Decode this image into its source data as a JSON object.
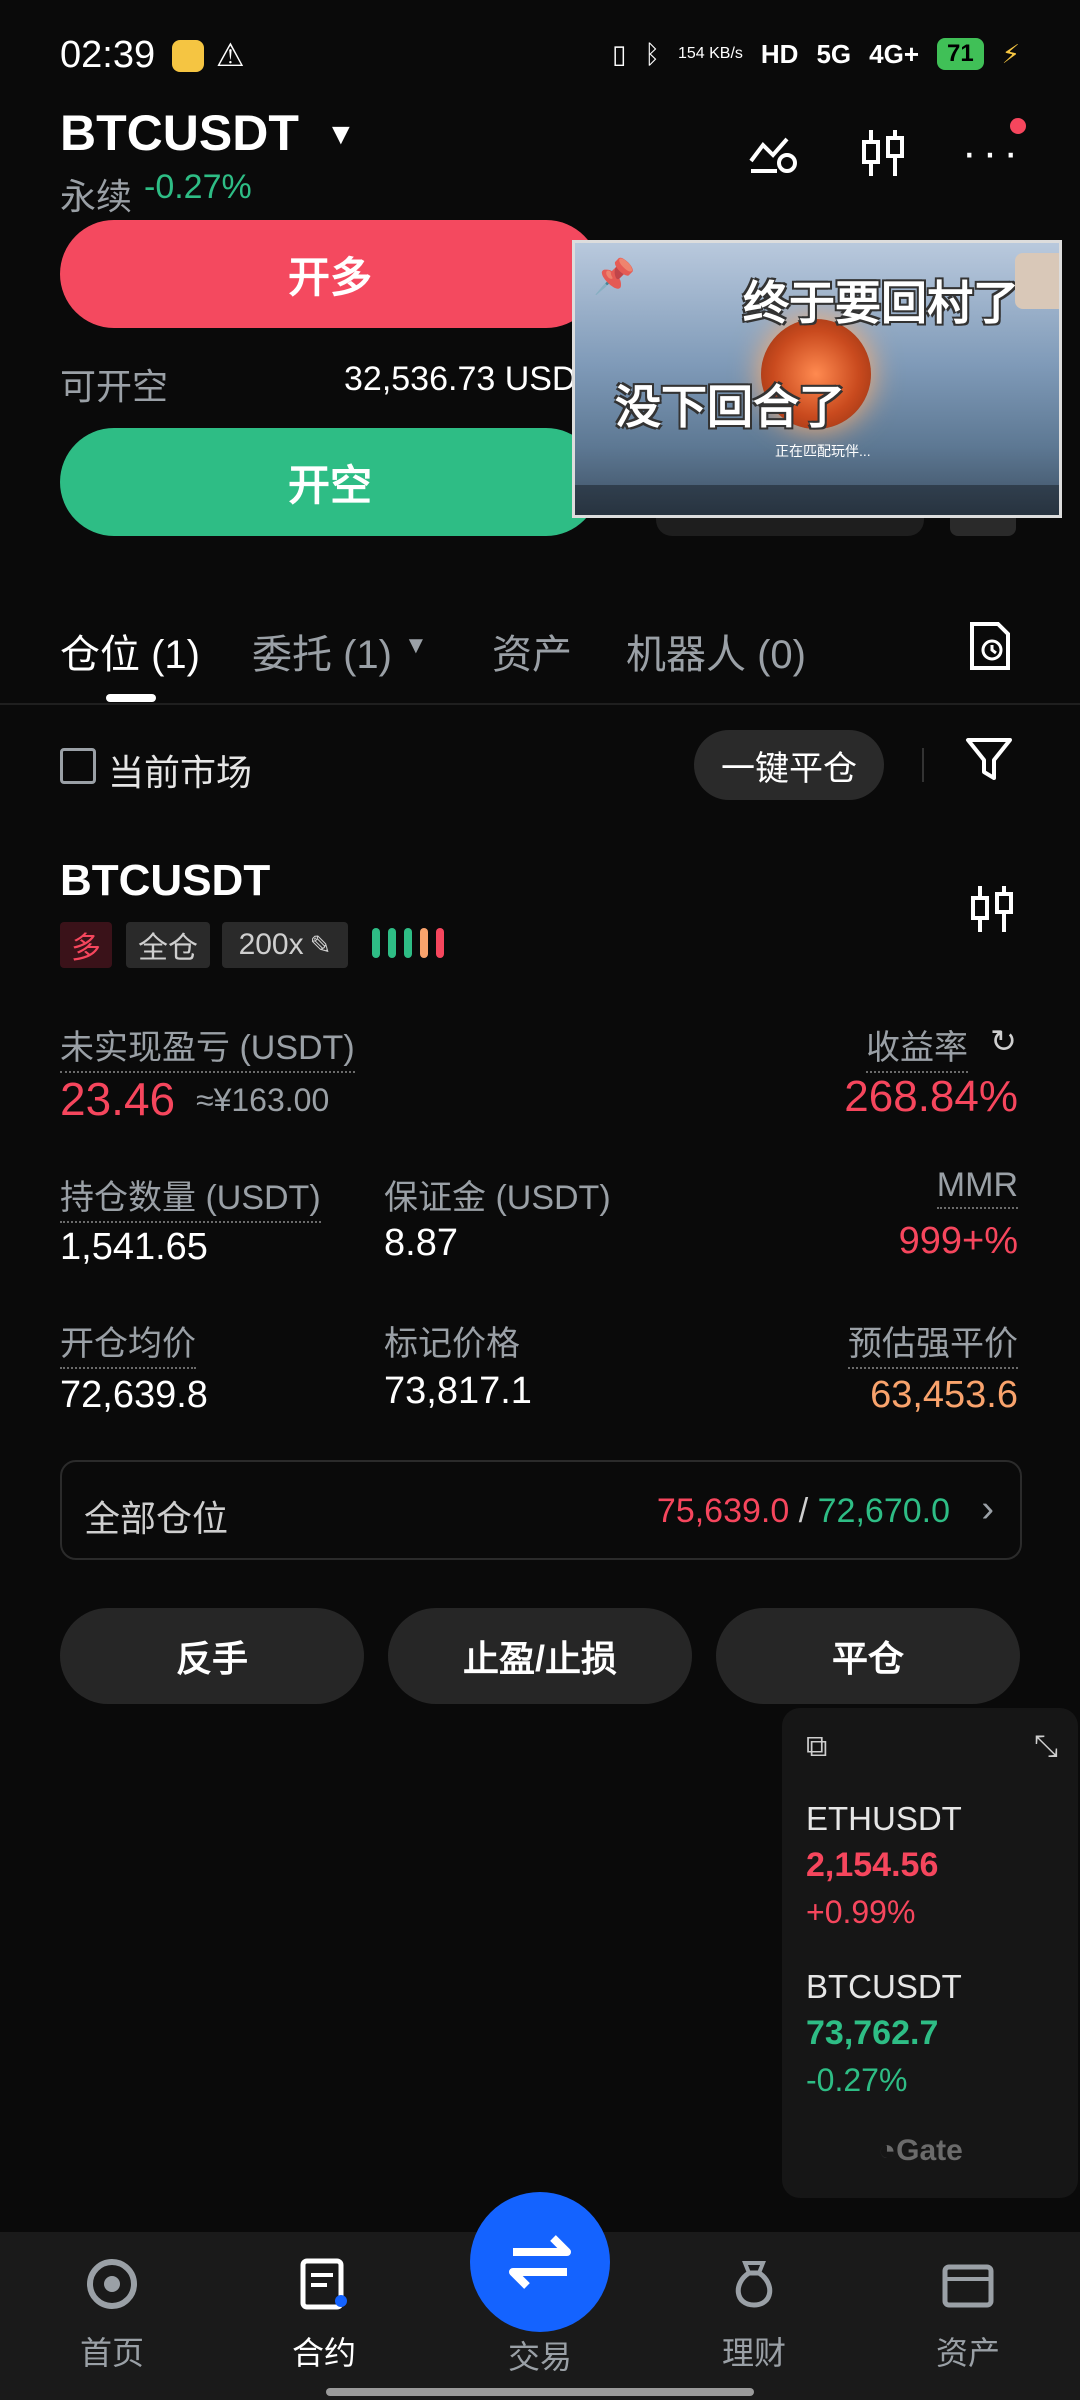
{
  "status": {
    "time": "02:39",
    "net_speed": "154 KB/s",
    "hd": "HD",
    "net_5g": "5G",
    "net_4g": "4G+",
    "battery": "71"
  },
  "header": {
    "pair": "BTCUSDT",
    "type": "永续",
    "change": "-0.27%"
  },
  "trade": {
    "long_label": "开多",
    "short_label": "开空",
    "avail_label": "可开空",
    "avail_value": "32,536.73 USD"
  },
  "video_overlay": {
    "caption_top": "终于要回村了",
    "caption_mid": "没下回合了",
    "caption_small": "正在匹配玩伴..."
  },
  "tabs": [
    {
      "label": "仓位 (1)"
    },
    {
      "label": "委托 (1)"
    },
    {
      "label": "资产"
    },
    {
      "label": "机器人 (0)"
    }
  ],
  "filter": {
    "current_market": "当前市场",
    "close_all": "一键平仓"
  },
  "position": {
    "symbol": "BTCUSDT",
    "side": "多",
    "margin_mode": "全仓",
    "leverage": "200x",
    "unrealized_label": "未实现盈亏 (USDT)",
    "unrealized_value": "23.46",
    "unrealized_cny": "≈¥163.00",
    "roe_label": "收益率",
    "roe_value": "268.84%",
    "size_label": "持仓数量 (USDT)",
    "size_value": "1,541.65",
    "margin_label": "保证金 (USDT)",
    "margin_value": "8.87",
    "mmr_label": "MMR",
    "mmr_value": "999+%",
    "entry_label": "开仓均价",
    "entry_value": "72,639.8",
    "mark_label": "标记价格",
    "mark_value": "73,817.1",
    "liq_label": "预估强平价",
    "liq_value": "63,453.6"
  },
  "all_positions": {
    "label": "全部仓位",
    "high": "75,639.0",
    "sep": "/",
    "low": "72,670.0"
  },
  "actions": {
    "reverse": "反手",
    "tpsl": "止盈/止损",
    "close": "平仓"
  },
  "ticker_widget": {
    "items": [
      {
        "symbol": "ETHUSDT",
        "price": "2,154.56",
        "change": "+0.99%"
      },
      {
        "symbol": "BTCUSDT",
        "price": "73,762.7",
        "change": "-0.27%"
      }
    ],
    "brand": "Gate"
  },
  "nav": [
    {
      "label": "首页"
    },
    {
      "label": "合约"
    },
    {
      "label": "交易"
    },
    {
      "label": "理财"
    },
    {
      "label": "资产"
    }
  ],
  "colors": {
    "up": "#2ebd85",
    "down": "#f6465d",
    "accent": "#1463ff"
  }
}
